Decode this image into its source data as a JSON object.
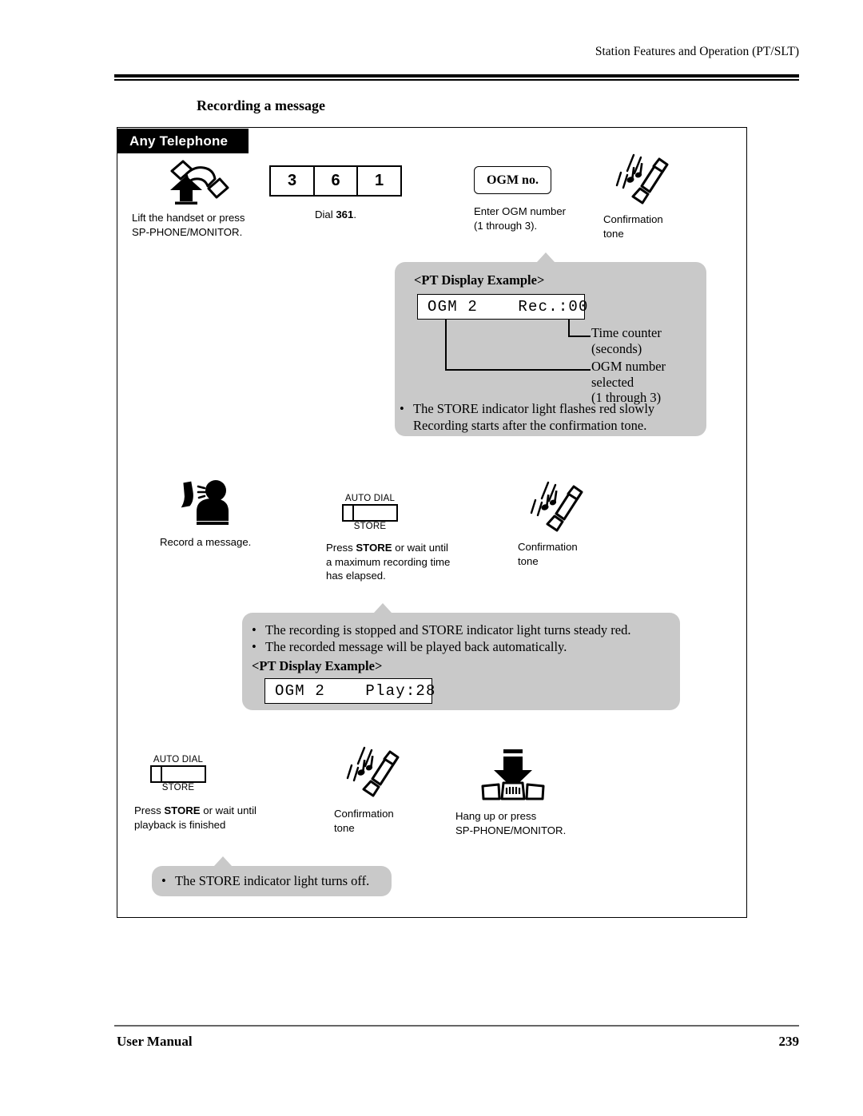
{
  "header": {
    "running_head": "Station Features and Operation (PT/SLT)"
  },
  "section": {
    "title": "Recording a message"
  },
  "panel": {
    "tab_label": "Any Telephone"
  },
  "steps": {
    "lift_handset": {
      "icon": "handset-lift-icon",
      "caption_line1": "Lift the handset or press",
      "caption_line2": "SP-PHONE/MONITOR."
    },
    "dial": {
      "digits": [
        "3",
        "6",
        "1"
      ],
      "caption_prefix": "Dial ",
      "caption_code": "361",
      "caption_suffix": "."
    },
    "enter_ogm": {
      "box_label": "OGM no.",
      "caption_line1": "Enter OGM number",
      "caption_line2": "(1 through 3)."
    },
    "confirmation_tone_1": {
      "icon": "handset-tone-icon",
      "caption_line1": "Confirmation",
      "caption_line2": "tone"
    },
    "record_message": {
      "icon": "person-speaking-icon",
      "caption_line1": "Record a message."
    },
    "press_store_1": {
      "key_top_label": "AUTO DIAL",
      "key_bottom_label": "STORE",
      "caption_prefix": "Press ",
      "caption_bold": "STORE",
      "caption_line1_rest": " or wait until",
      "caption_line2": "a maximum recording time",
      "caption_line3": "has elapsed."
    },
    "confirmation_tone_2": {
      "icon": "handset-tone-icon",
      "caption_line1": "Confirmation",
      "caption_line2": "tone"
    },
    "press_store_2": {
      "key_top_label": "AUTO DIAL",
      "key_bottom_label": "STORE",
      "caption_prefix": "Press ",
      "caption_bold": "STORE",
      "caption_line1_rest": " or wait until",
      "caption_line2": "playback is finished"
    },
    "confirmation_tone_3": {
      "icon": "handset-tone-icon",
      "caption_line1": "Confirmation",
      "caption_line2": "tone"
    },
    "hang_up": {
      "icon": "handset-hangup-icon",
      "caption_line1": "Hang up or press",
      "caption_line2": "SP-PHONE/MONITOR."
    }
  },
  "callout_rec": {
    "pt_display_heading": "<PT Display Example>",
    "lcd_text": "OGM 2    Rec.:00",
    "annotation_time_line1": "Time counter",
    "annotation_time_line2": "(seconds)",
    "annotation_ogm_line1": "OGM number",
    "annotation_ogm_line2": "selected",
    "annotation_ogm_line3": "(1 through 3)",
    "note_line1": "The STORE indicator light flashes red slowly",
    "note_line2": "Recording starts after the confirmation tone."
  },
  "callout_play": {
    "note_line1": "The recording is stopped and STORE indicator light turns steady red.",
    "note_line2": "The recorded message will be played back automatically.",
    "pt_display_heading": "<PT Display Example>",
    "lcd_text": "OGM 2    Play:28"
  },
  "callout_off": {
    "note_line1": "The STORE indicator light turns off."
  },
  "footer": {
    "left": "User Manual",
    "page_number": "239"
  },
  "colors": {
    "callout_gray": "#c9c9c9",
    "ink": "#000000",
    "rule_gray": "#666666"
  }
}
